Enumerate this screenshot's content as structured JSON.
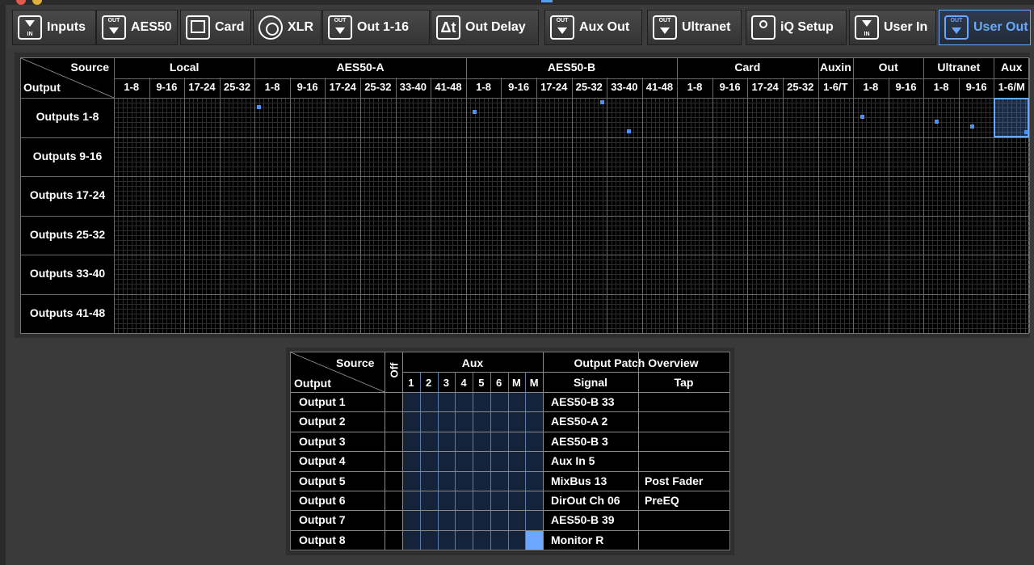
{
  "tabs": [
    {
      "label": "Inputs",
      "icon": "in-icon",
      "active": false
    },
    {
      "label": "AES50",
      "icon": "out-icon",
      "active": false
    },
    {
      "label": "Card",
      "icon": "card-icon",
      "active": false
    },
    {
      "label": "XLR",
      "icon": "xlr-icon",
      "active": false
    },
    {
      "label": "Out 1-16",
      "icon": "out-icon",
      "active": false
    },
    {
      "label": "Out Delay",
      "icon": "delay-icon",
      "active": false
    },
    {
      "label": "Aux Out",
      "icon": "out-icon",
      "active": false
    },
    {
      "label": "Ultranet",
      "icon": "out-icon",
      "active": false
    },
    {
      "label": "iQ Setup",
      "icon": "speaker-icon",
      "active": false
    },
    {
      "label": "User In",
      "icon": "in-icon",
      "active": false
    },
    {
      "label": "User Out",
      "icon": "out-icon",
      "active": true
    }
  ],
  "icon_text": {
    "in": "IN",
    "out": "OUT"
  },
  "patch_grid": {
    "corner_source": "Source",
    "corner_output": "Output",
    "groups": [
      {
        "label": "Local",
        "subs": [
          "1-8",
          "9-16",
          "17-24",
          "25-32"
        ]
      },
      {
        "label": "AES50-A",
        "subs": [
          "1-8",
          "9-16",
          "17-24",
          "25-32",
          "33-40",
          "41-48"
        ]
      },
      {
        "label": "AES50-B",
        "subs": [
          "1-8",
          "9-16",
          "17-24",
          "25-32",
          "33-40",
          "41-48"
        ]
      },
      {
        "label": "Card",
        "subs": [
          "1-8",
          "9-16",
          "17-24",
          "25-32"
        ]
      },
      {
        "label": "Auxin",
        "subs": [
          "1-6/T"
        ]
      },
      {
        "label": "Out",
        "subs": [
          "1-8",
          "9-16"
        ]
      },
      {
        "label": "Ultranet",
        "subs": [
          "1-8",
          "9-16"
        ]
      },
      {
        "label": "Aux",
        "subs": [
          "1-6/M"
        ]
      }
    ],
    "rows": [
      "Outputs 1-8",
      "Outputs 9-16",
      "Outputs 17-24",
      "Outputs 25-32",
      "Outputs 33-40",
      "Outputs 41-48"
    ],
    "selected_cell": {
      "row": 0,
      "col": 27
    }
  },
  "aux_grid": {
    "corner_source": "Source",
    "corner_output": "Output",
    "off_label": "Off",
    "group_label": "Aux",
    "columns": [
      "1",
      "2",
      "3",
      "4",
      "5",
      "6",
      "M",
      "M"
    ],
    "overview_title": "Output  Patch Overview",
    "signal_header": "Signal",
    "tap_header": "Tap",
    "rows": [
      {
        "output": "Output 1",
        "signal": "AES50-B 33",
        "tap": ""
      },
      {
        "output": "Output 2",
        "signal": "AES50-A 2",
        "tap": ""
      },
      {
        "output": "Output 3",
        "signal": "AES50-B 3",
        "tap": ""
      },
      {
        "output": "Output 4",
        "signal": "Aux In 5",
        "tap": ""
      },
      {
        "output": "Output 5",
        "signal": "MixBus 13",
        "tap": "Post Fader"
      },
      {
        "output": "Output 6",
        "signal": "DirOut Ch 06",
        "tap": "PreEQ"
      },
      {
        "output": "Output 7",
        "signal": "AES50-B 39",
        "tap": ""
      },
      {
        "output": "Output 8",
        "signal": "Monitor R",
        "tap": ""
      }
    ],
    "selected": {
      "row": 7,
      "col": 7
    }
  },
  "colors": {
    "accent": "#6aa8ff",
    "mark": "#4c90ff",
    "aux_cell": "#14233a"
  }
}
